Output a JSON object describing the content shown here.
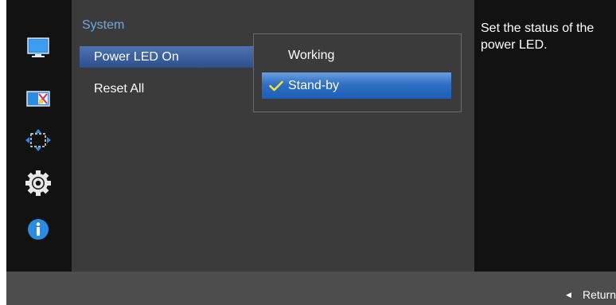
{
  "sidebar": {
    "icons": [
      {
        "name": "picture-icon",
        "color": "#2b8be0"
      },
      {
        "name": "color-icon",
        "color": "#2b8be0"
      },
      {
        "name": "size-position-icon",
        "color": "#2b8be0"
      },
      {
        "name": "settings-gear-icon",
        "color": "#ffffff"
      },
      {
        "name": "information-icon",
        "color": "#2b8be0"
      }
    ]
  },
  "menu": {
    "section_title": "System",
    "items": [
      {
        "label": "Power LED On",
        "selected": true
      },
      {
        "label": "Reset All",
        "selected": false
      }
    ]
  },
  "popup": {
    "options": [
      {
        "label": "Working",
        "checked": false
      },
      {
        "label": "Stand-by",
        "checked": true
      }
    ]
  },
  "help": {
    "text": "Set the status of the power LED."
  },
  "footer": {
    "return_label": "Return"
  },
  "colors": {
    "accent": "#2f6fc4",
    "section_title": "#6ea7e5",
    "check": "#f5e22a"
  }
}
